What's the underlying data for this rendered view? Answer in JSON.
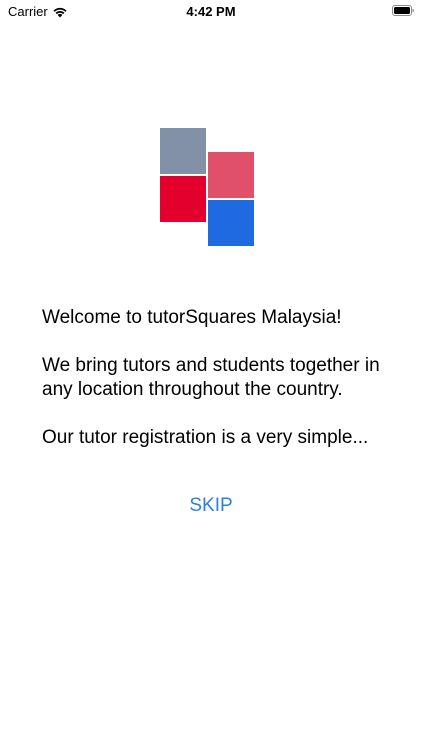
{
  "status_bar": {
    "carrier": "Carrier",
    "time": "4:42 PM",
    "wifi_icon": "wifi-icon",
    "battery_icon": "battery-icon"
  },
  "logo": {
    "icon": "tutorsquares-logo",
    "colors": {
      "gray": "#8290a8",
      "pink": "#e0506a",
      "red": "#e3002d",
      "blue": "#1f6ae0"
    }
  },
  "welcome": {
    "line1": "Welcome to tutorSquares Malaysia!",
    "line2": "We bring tutors and students together in any location throughout the country.",
    "line3": "Our tutor registration is a very simple..."
  },
  "actions": {
    "skip_label": "SKIP",
    "skip_color": "#2f7fd9"
  }
}
